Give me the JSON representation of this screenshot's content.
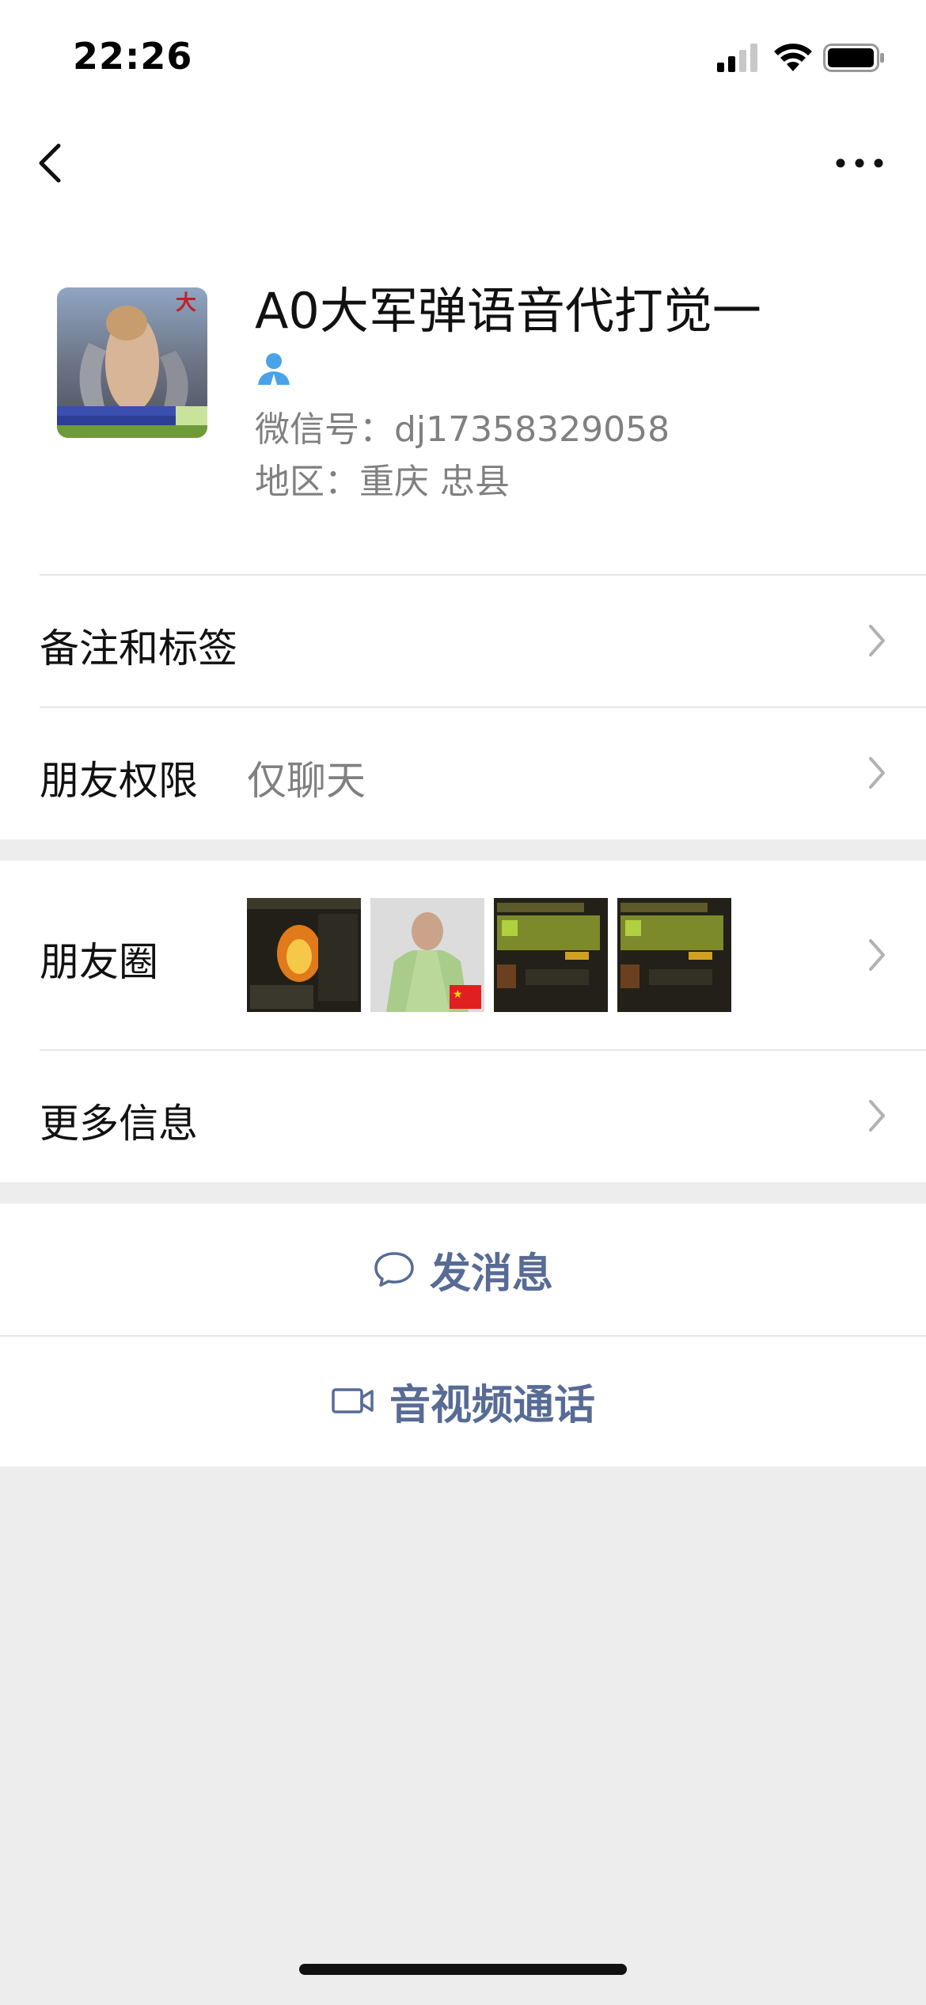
{
  "status_bar": {
    "time": "22:26",
    "signal_icon": "cellular-signal-icon",
    "wifi_icon": "wifi-icon",
    "battery_icon": "battery-icon"
  },
  "nav": {
    "back_icon": "chevron-left-icon",
    "more_icon": "more-dots-icon"
  },
  "profile": {
    "nickname": "A0大军弹语音代打觉一",
    "gender_icon": "person-icon",
    "wechat_id": "微信号：dj17358329058",
    "region": "地区：重庆 忠县",
    "avatar_icon": "avatar-image"
  },
  "cells": {
    "remark_tags": {
      "label": "备注和标签"
    },
    "friend_permission": {
      "label": "朋友权限",
      "value": "仅聊天"
    },
    "moments": {
      "label": "朋友圈"
    },
    "more_info": {
      "label": "更多信息"
    }
  },
  "actions": {
    "send_message": {
      "label": "发消息",
      "icon": "chat-bubble-icon"
    },
    "video_call": {
      "label": "音视频通话",
      "icon": "video-camera-icon"
    }
  },
  "colors": {
    "link_blue": "#576b95",
    "gender_blue": "#4aa3e8",
    "background": "#ededed"
  }
}
